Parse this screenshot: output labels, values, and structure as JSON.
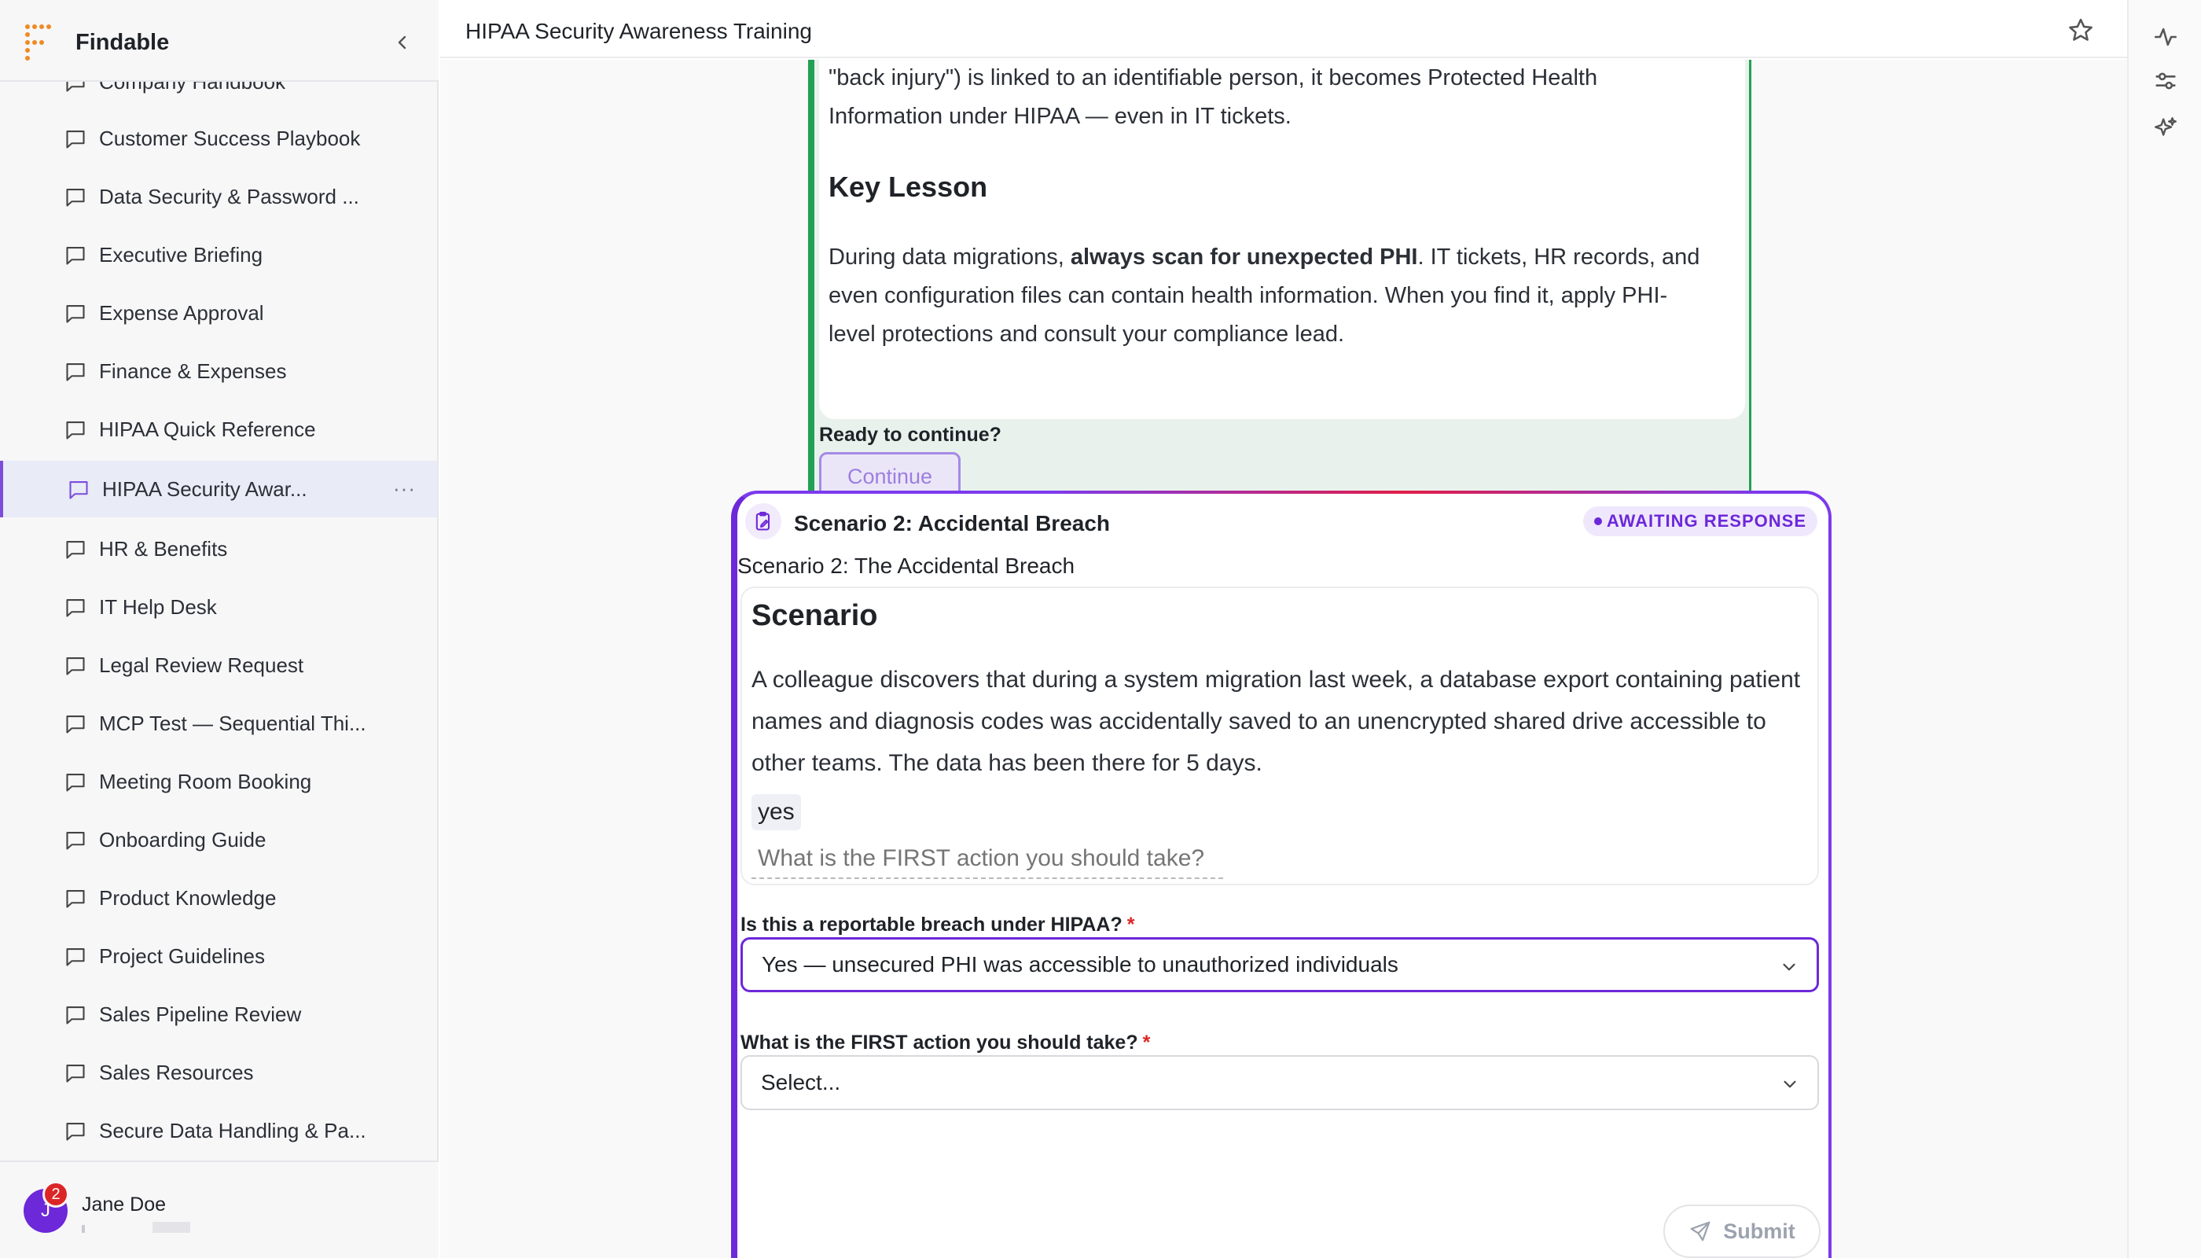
{
  "app": {
    "name": "Findable"
  },
  "header": {
    "title": "HIPAA Security Awareness Training"
  },
  "sidebar": {
    "items": [
      {
        "label": "Company Handbook"
      },
      {
        "label": "Customer Success Playbook"
      },
      {
        "label": "Data Security & Password ..."
      },
      {
        "label": "Executive Briefing"
      },
      {
        "label": "Expense Approval"
      },
      {
        "label": "Finance & Expenses"
      },
      {
        "label": "HIPAA Quick Reference"
      },
      {
        "label": "HIPAA Security Awar...",
        "active": true
      },
      {
        "label": "HR & Benefits"
      },
      {
        "label": "IT Help Desk"
      },
      {
        "label": "Legal Review Request"
      },
      {
        "label": "MCP Test — Sequential Thi..."
      },
      {
        "label": "Meeting Room Booking"
      },
      {
        "label": "Onboarding Guide"
      },
      {
        "label": "Product Knowledge"
      },
      {
        "label": "Project Guidelines"
      },
      {
        "label": "Sales Pipeline Review"
      },
      {
        "label": "Sales Resources"
      },
      {
        "label": "Secure Data Handling & Pa..."
      }
    ],
    "more_label": "···"
  },
  "user": {
    "name": "Jane Doe",
    "initial": "J",
    "notifications": "2"
  },
  "previous_card": {
    "text_line1": "\"back injury\") is linked to an identifiable person, it becomes Protected Health",
    "text_line2": "Information under HIPAA — even in IT tickets.",
    "heading": "Key Lesson",
    "lesson_intro": "During data migrations, ",
    "lesson_bold": "always scan for unexpected PHI",
    "lesson_rest_line1": ". IT tickets, HR records, and",
    "lesson_line2": "even configuration files can contain health information. When you find it, apply PHI-",
    "lesson_line3": "level protections and consult your compliance lead.",
    "ready": "Ready to continue?",
    "continue_label": "Continue"
  },
  "scenario_card": {
    "title": "Scenario 2: Accidental Breach",
    "status": "AWAITING RESPONSE",
    "subtitle": "Scenario 2: The Accidental Breach",
    "box_heading": "Scenario",
    "description": "A colleague discovers that during a system migration last week, a database export containing patient names and diagnosis codes was accidentally saved to an unencrypted shared drive accessible to other teams. The data has been there for 5 days.",
    "chip": "yes",
    "chip_placeholder": "What is the FIRST action you should take?",
    "q1_label": "Is this a reportable breach under HIPAA?",
    "q1_value": "Yes — unsecured PHI was accessible to unauthorized individuals",
    "q2_label": "What is the FIRST action you should take?",
    "q2_value": "Select...",
    "required_mark": "*",
    "submit_label": "Submit"
  },
  "colors": {
    "accent": "#6d28d9",
    "success": "#22a055",
    "danger": "#dc2626"
  }
}
